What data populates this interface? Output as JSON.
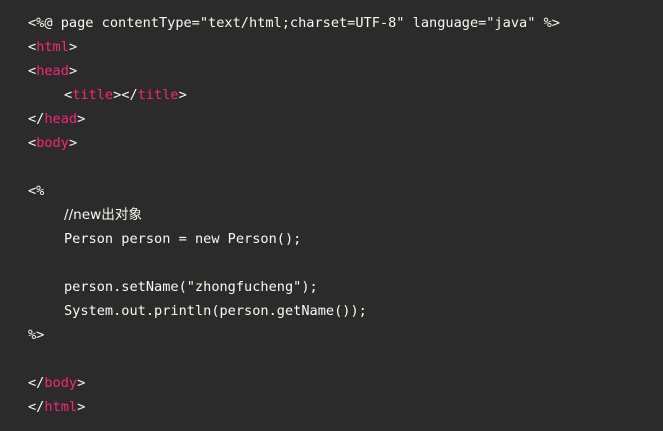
{
  "code": {
    "line1": "<%@ page contentType=\"text/html;charset=UTF-8\" language=\"java\" %>",
    "line2_open": "<",
    "line2_name": "html",
    "line2_close": ">",
    "line3_open": "<",
    "line3_name": "head",
    "line3_close": ">",
    "line4_open": "<",
    "line4_name": "title",
    "line4_mid": "></",
    "line4_name2": "title",
    "line4_close": ">",
    "line5_open": "</",
    "line5_name": "head",
    "line5_close": ">",
    "line6_open": "<",
    "line6_name": "body",
    "line6_close": ">",
    "line8": "<%",
    "line9": "//new出对象",
    "line10": "Person person = new Person();",
    "line12": "person.setName(\"zhongfucheng\");",
    "line13": "System.out.println(person.getName());",
    "line14": "%>",
    "line16_open": "</",
    "line16_name": "body",
    "line16_close": ">",
    "line17_open": "</",
    "line17_name": "html",
    "line17_close": ">"
  }
}
